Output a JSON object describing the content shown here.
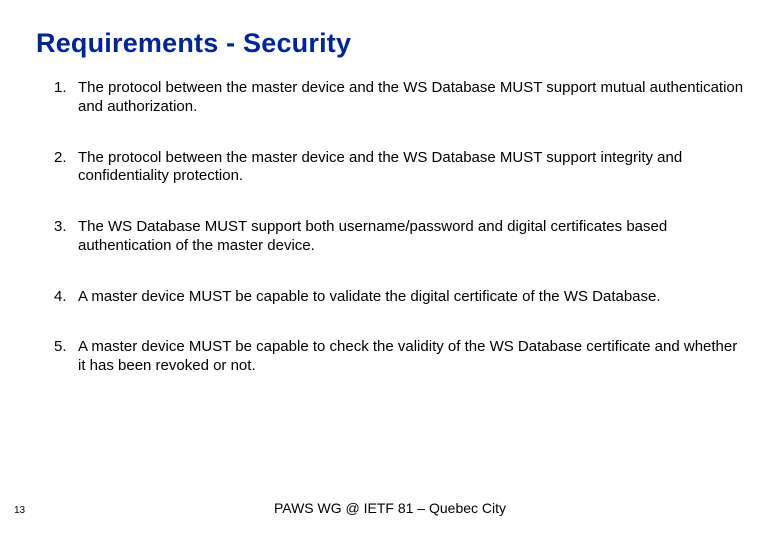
{
  "title": "Requirements - Security",
  "items": [
    {
      "num": "1.",
      "text": "The protocol between the master device and the WS Database MUST support mutual authentication and authorization."
    },
    {
      "num": "2.",
      "text": "The protocol between the master device and the WS Database MUST support integrity and confidentiality protection."
    },
    {
      "num": "3.",
      "text": "The WS Database MUST support both username/password and digital certificates based authentication of the master device."
    },
    {
      "num": "4.",
      "text": "A master device MUST be capable to validate the digital certificate of the WS Database."
    },
    {
      "num": "5.",
      "text": "A master device MUST be capable to check the validity of the WS Database certificate and whether it has been revoked or not."
    }
  ],
  "page_number": "13",
  "footer": "PAWS WG @ IETF 81 – Quebec City"
}
